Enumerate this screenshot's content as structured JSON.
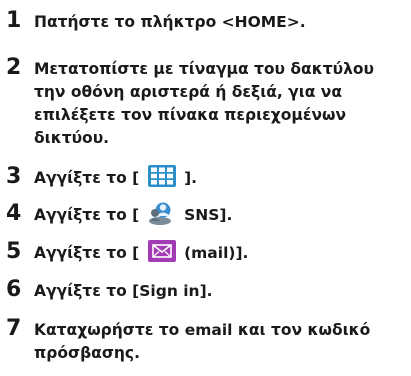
{
  "steps": [
    {
      "number": "1",
      "lines": [
        "Πατήστε το πλήκτρο <HOME>."
      ]
    },
    {
      "number": "2",
      "lines": [
        "Μετατοπίστε με τίναγμα του δακτύλου",
        "την οθόνη αριστερά ή δεξιά, για να",
        "επιλέξετε τον πίνακα περιεχομένων",
        "δικτύου."
      ]
    },
    {
      "number": "3",
      "before": "Αγγίξτε το [",
      "after": "].",
      "icon": "apps-grid-icon"
    },
    {
      "number": "4",
      "before": "Αγγίξτε το [",
      "after": "SNS].",
      "icon": "sns-icon"
    },
    {
      "number": "5",
      "before": "Αγγίξτε το [",
      "after": "(mail)].",
      "icon": "mail-icon"
    },
    {
      "number": "6",
      "lines": [
        "Αγγίξτε το [Sign in]."
      ]
    },
    {
      "number": "7",
      "lines": [
        "Καταχωρήστε το email και τον κωδικό",
        "πρόσβασης."
      ]
    }
  ],
  "colors": {
    "text": "#1a1a1a",
    "grid_icon": "#2b8fc9",
    "sns_icon": "#3a8fd0",
    "mail_icon": "#a33bb5"
  }
}
